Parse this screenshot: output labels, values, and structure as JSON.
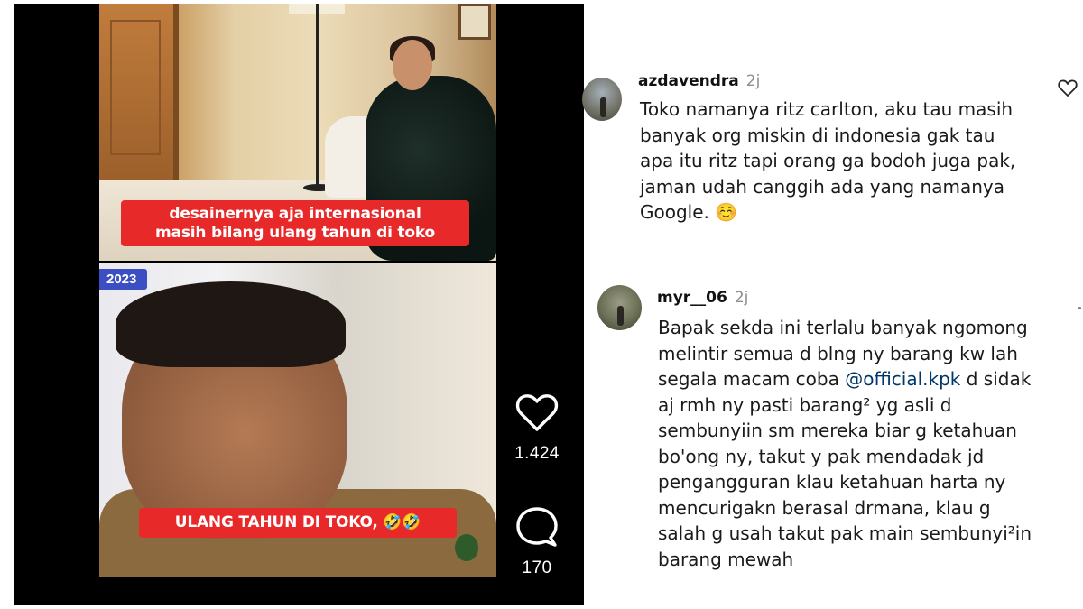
{
  "reel": {
    "year_tag": "2023",
    "caption_top": [
      "desainernya aja internasional",
      "masih bilang ulang tahun di toko"
    ],
    "caption_bottom": "ULANG TAHUN DI TOKO, 🤣🤣",
    "likes": "1.424",
    "comments": "170",
    "icons": {
      "like": "heart-outline-icon",
      "comment": "speech-bubble-icon"
    }
  },
  "comments": [
    {
      "username": "azdavendra",
      "time": "2j",
      "lines": [
        "Toko namanya ritz carlton, aku tau masih",
        "banyak org miskin di indonesia gak tau",
        "apa itu ritz tapi orang ga bodoh juga pak,",
        "jaman udah canggih ada yang namanya",
        "Google. ☺️"
      ]
    },
    {
      "username": "myr__06",
      "time": "2j",
      "lines": [
        "Bapak sekda ini terlalu banyak ngomong",
        "melintir semua d blng ny barang kw lah",
        "segala macam coba ",
        "aj rmh ny pasti barang² yg asli d",
        "sembunyiin sm mereka biar g ketahuan",
        "bo'ong ny, takut y pak mendadak jd",
        "pengangguran klau ketahuan harta ny",
        "mencurigakn berasal drmana, klau g",
        "salah g usah takut pak main sembunyi²in",
        "barang mewah"
      ],
      "mention": "@official.kpk",
      "mention_suffix": " d sidak"
    }
  ],
  "colors": {
    "caption_red": "#e8292a",
    "year_tag_blue": "#3b4fc2",
    "mention_blue": "#00376b",
    "muted_gray": "#8e8e8e"
  }
}
